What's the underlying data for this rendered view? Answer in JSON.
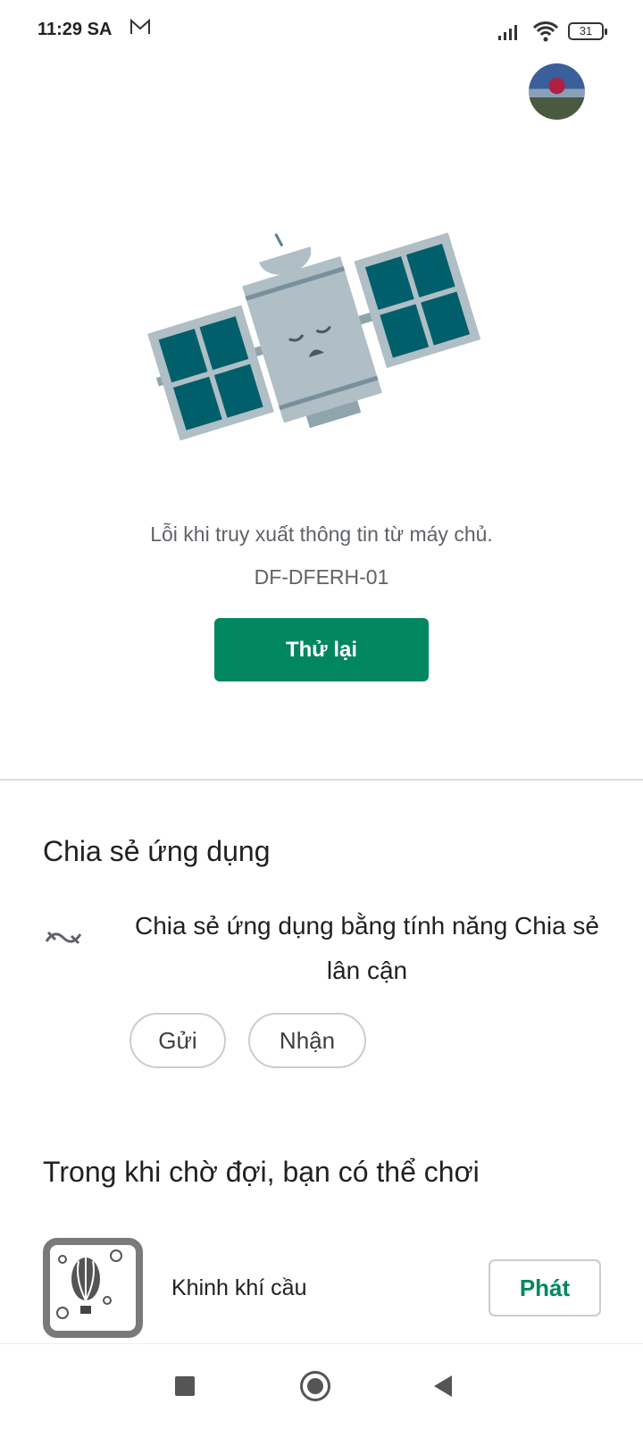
{
  "status_bar": {
    "time": "11:29 SA",
    "notification_icon": "gmail-icon",
    "battery": "31"
  },
  "error": {
    "message": "Lỗi khi truy xuất thông tin từ máy chủ.",
    "code": "DF-DFERH-01",
    "retry_label": "Thử lại"
  },
  "share": {
    "title": "Chia sẻ ứng dụng",
    "text": "Chia sẻ ứng dụng bằng tính năng Chia sẻ lân cận",
    "send_label": "Gửi",
    "receive_label": "Nhận",
    "icon": "nearby-share-icon"
  },
  "games": {
    "title": "Trong khi chờ đợi, bạn có thể chơi",
    "items": [
      {
        "name": "Khinh khí cầu",
        "play_label": "Phát",
        "icon": "balloon-game-icon"
      }
    ]
  },
  "colors": {
    "accent": "#01875f",
    "panel": "#005f6b",
    "body": "#b0bec5"
  }
}
